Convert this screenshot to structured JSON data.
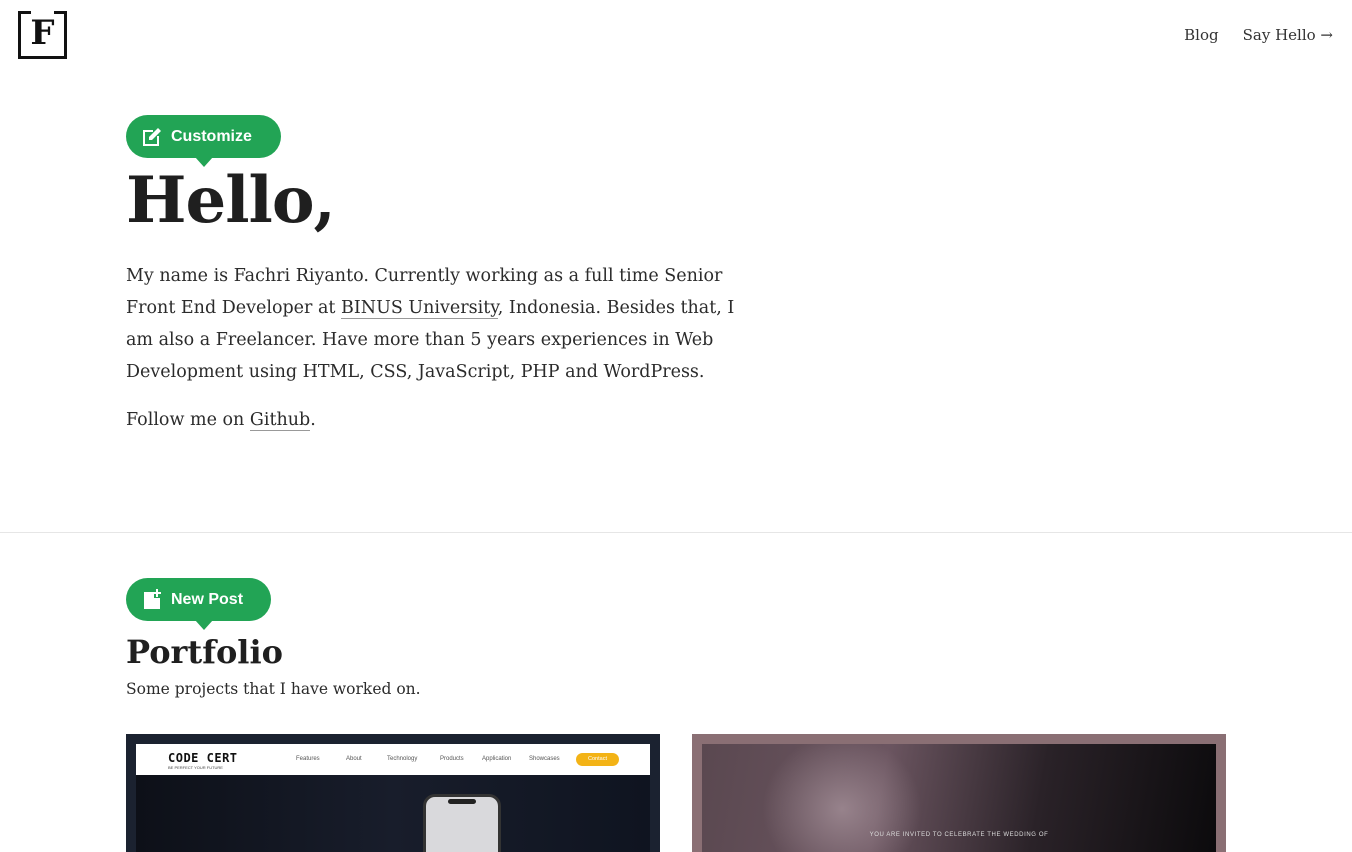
{
  "header": {
    "logo_letter": "F",
    "nav": [
      {
        "label": "Blog"
      },
      {
        "label": "Say Hello →"
      }
    ]
  },
  "admin": {
    "customize_label": "Customize",
    "new_post_label": "New Post",
    "accent_color": "#22a455"
  },
  "hero": {
    "title": "Hello,",
    "intro_before_link": "My name is Fachri Riyanto. Currently working as a full time Senior Front End Developer at ",
    "intro_link": "BINUS University",
    "intro_after_link": ", Indonesia. Besides that, I am also a Freelancer. Have more than 5 years experiences in Web Development using HTML, CSS, JavaScript, PHP and WordPress.",
    "follow_before": "Follow me on ",
    "follow_link": "Github",
    "follow_after": "."
  },
  "portfolio": {
    "title": "Portfolio",
    "subtitle": "Some projects that I have worked on.",
    "cards": [
      {
        "logo": "CODE CERT",
        "logo_sub": "BE PERFECT YOUR FUTURE",
        "menu": [
          "Features",
          "About",
          "Technology",
          "Products",
          "Application",
          "Showcases"
        ],
        "contact": "Contact"
      },
      {
        "text": "YOU ARE INVITED TO CELEBRATE THE WEDDING OF"
      }
    ]
  }
}
